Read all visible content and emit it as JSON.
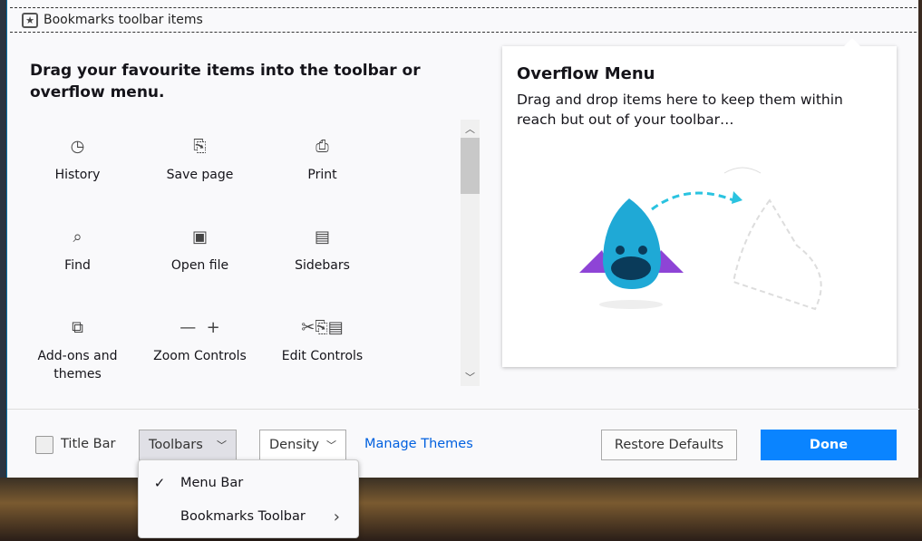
{
  "bookmarks_toolbar": {
    "label": "Bookmarks toolbar items",
    "icon": "star-icon"
  },
  "heading": "Drag your favourite items into the toolbar or overflow menu.",
  "items": [
    {
      "label": "History",
      "icon": "clock-icon"
    },
    {
      "label": "Save page",
      "icon": "save-icon"
    },
    {
      "label": "Print",
      "icon": "printer-icon"
    },
    {
      "label": "Find",
      "icon": "search-icon"
    },
    {
      "label": "Open file",
      "icon": "folder-open-icon"
    },
    {
      "label": "Sidebars",
      "icon": "sidebar-icon"
    },
    {
      "label": "Add-ons and themes",
      "icon": "puzzle-icon"
    },
    {
      "label": "Zoom Controls",
      "icon": "zoom-icon"
    },
    {
      "label": "Edit Controls",
      "icon": "edit-icon"
    }
  ],
  "overflow": {
    "title": "Overflow Menu",
    "description": "Drag and drop items here to keep them within reach but out of your toolbar…"
  },
  "footer": {
    "title_bar": "Title Bar",
    "toolbars": "Toolbars",
    "density": "Density",
    "manage_themes": "Manage Themes",
    "restore": "Restore Defaults",
    "done": "Done"
  },
  "menu": {
    "items": [
      {
        "label": "Menu Bar",
        "checked": true
      },
      {
        "label": "Bookmarks Toolbar",
        "submenu": true
      }
    ]
  },
  "colors": {
    "accent": "#0060df",
    "done_bg": "#0a84ff"
  }
}
